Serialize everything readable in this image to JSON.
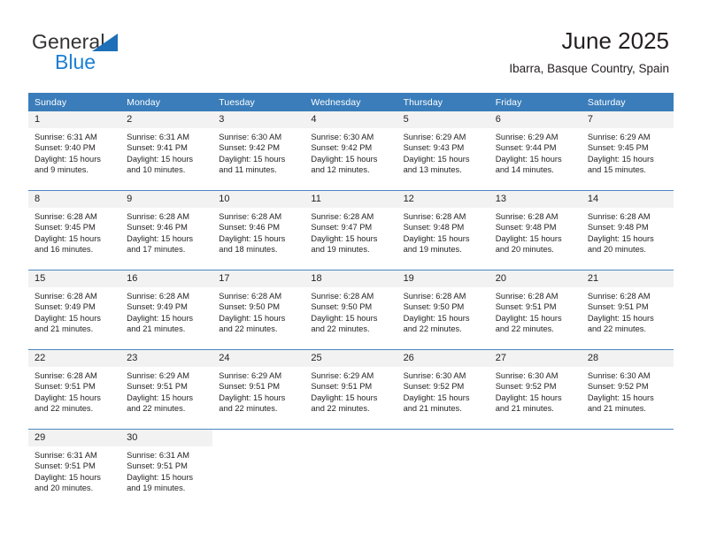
{
  "brand": {
    "name_top": "General",
    "name_bottom": "Blue",
    "triangle_color": "#1d6fb8",
    "blue_text_color": "#1b7fd4"
  },
  "header": {
    "title": "June 2025",
    "location": "Ibarra, Basque Country, Spain"
  },
  "theme": {
    "header_row_bg": "#3a7dba",
    "header_row_text": "#ffffff",
    "row_divider": "#4a86c4",
    "daynum_bg": "#f2f2f2",
    "body_text": "#231f20"
  },
  "weekdays": [
    "Sunday",
    "Monday",
    "Tuesday",
    "Wednesday",
    "Thursday",
    "Friday",
    "Saturday"
  ],
  "weeks": [
    [
      {
        "day": "1",
        "sunrise": "Sunrise: 6:31 AM",
        "sunset": "Sunset: 9:40 PM",
        "daylight_1": "Daylight: 15 hours",
        "daylight_2": "and 9 minutes."
      },
      {
        "day": "2",
        "sunrise": "Sunrise: 6:31 AM",
        "sunset": "Sunset: 9:41 PM",
        "daylight_1": "Daylight: 15 hours",
        "daylight_2": "and 10 minutes."
      },
      {
        "day": "3",
        "sunrise": "Sunrise: 6:30 AM",
        "sunset": "Sunset: 9:42 PM",
        "daylight_1": "Daylight: 15 hours",
        "daylight_2": "and 11 minutes."
      },
      {
        "day": "4",
        "sunrise": "Sunrise: 6:30 AM",
        "sunset": "Sunset: 9:42 PM",
        "daylight_1": "Daylight: 15 hours",
        "daylight_2": "and 12 minutes."
      },
      {
        "day": "5",
        "sunrise": "Sunrise: 6:29 AM",
        "sunset": "Sunset: 9:43 PM",
        "daylight_1": "Daylight: 15 hours",
        "daylight_2": "and 13 minutes."
      },
      {
        "day": "6",
        "sunrise": "Sunrise: 6:29 AM",
        "sunset": "Sunset: 9:44 PM",
        "daylight_1": "Daylight: 15 hours",
        "daylight_2": "and 14 minutes."
      },
      {
        "day": "7",
        "sunrise": "Sunrise: 6:29 AM",
        "sunset": "Sunset: 9:45 PM",
        "daylight_1": "Daylight: 15 hours",
        "daylight_2": "and 15 minutes."
      }
    ],
    [
      {
        "day": "8",
        "sunrise": "Sunrise: 6:28 AM",
        "sunset": "Sunset: 9:45 PM",
        "daylight_1": "Daylight: 15 hours",
        "daylight_2": "and 16 minutes."
      },
      {
        "day": "9",
        "sunrise": "Sunrise: 6:28 AM",
        "sunset": "Sunset: 9:46 PM",
        "daylight_1": "Daylight: 15 hours",
        "daylight_2": "and 17 minutes."
      },
      {
        "day": "10",
        "sunrise": "Sunrise: 6:28 AM",
        "sunset": "Sunset: 9:46 PM",
        "daylight_1": "Daylight: 15 hours",
        "daylight_2": "and 18 minutes."
      },
      {
        "day": "11",
        "sunrise": "Sunrise: 6:28 AM",
        "sunset": "Sunset: 9:47 PM",
        "daylight_1": "Daylight: 15 hours",
        "daylight_2": "and 19 minutes."
      },
      {
        "day": "12",
        "sunrise": "Sunrise: 6:28 AM",
        "sunset": "Sunset: 9:48 PM",
        "daylight_1": "Daylight: 15 hours",
        "daylight_2": "and 19 minutes."
      },
      {
        "day": "13",
        "sunrise": "Sunrise: 6:28 AM",
        "sunset": "Sunset: 9:48 PM",
        "daylight_1": "Daylight: 15 hours",
        "daylight_2": "and 20 minutes."
      },
      {
        "day": "14",
        "sunrise": "Sunrise: 6:28 AM",
        "sunset": "Sunset: 9:48 PM",
        "daylight_1": "Daylight: 15 hours",
        "daylight_2": "and 20 minutes."
      }
    ],
    [
      {
        "day": "15",
        "sunrise": "Sunrise: 6:28 AM",
        "sunset": "Sunset: 9:49 PM",
        "daylight_1": "Daylight: 15 hours",
        "daylight_2": "and 21 minutes."
      },
      {
        "day": "16",
        "sunrise": "Sunrise: 6:28 AM",
        "sunset": "Sunset: 9:49 PM",
        "daylight_1": "Daylight: 15 hours",
        "daylight_2": "and 21 minutes."
      },
      {
        "day": "17",
        "sunrise": "Sunrise: 6:28 AM",
        "sunset": "Sunset: 9:50 PM",
        "daylight_1": "Daylight: 15 hours",
        "daylight_2": "and 22 minutes."
      },
      {
        "day": "18",
        "sunrise": "Sunrise: 6:28 AM",
        "sunset": "Sunset: 9:50 PM",
        "daylight_1": "Daylight: 15 hours",
        "daylight_2": "and 22 minutes."
      },
      {
        "day": "19",
        "sunrise": "Sunrise: 6:28 AM",
        "sunset": "Sunset: 9:50 PM",
        "daylight_1": "Daylight: 15 hours",
        "daylight_2": "and 22 minutes."
      },
      {
        "day": "20",
        "sunrise": "Sunrise: 6:28 AM",
        "sunset": "Sunset: 9:51 PM",
        "daylight_1": "Daylight: 15 hours",
        "daylight_2": "and 22 minutes."
      },
      {
        "day": "21",
        "sunrise": "Sunrise: 6:28 AM",
        "sunset": "Sunset: 9:51 PM",
        "daylight_1": "Daylight: 15 hours",
        "daylight_2": "and 22 minutes."
      }
    ],
    [
      {
        "day": "22",
        "sunrise": "Sunrise: 6:28 AM",
        "sunset": "Sunset: 9:51 PM",
        "daylight_1": "Daylight: 15 hours",
        "daylight_2": "and 22 minutes."
      },
      {
        "day": "23",
        "sunrise": "Sunrise: 6:29 AM",
        "sunset": "Sunset: 9:51 PM",
        "daylight_1": "Daylight: 15 hours",
        "daylight_2": "and 22 minutes."
      },
      {
        "day": "24",
        "sunrise": "Sunrise: 6:29 AM",
        "sunset": "Sunset: 9:51 PM",
        "daylight_1": "Daylight: 15 hours",
        "daylight_2": "and 22 minutes."
      },
      {
        "day": "25",
        "sunrise": "Sunrise: 6:29 AM",
        "sunset": "Sunset: 9:51 PM",
        "daylight_1": "Daylight: 15 hours",
        "daylight_2": "and 22 minutes."
      },
      {
        "day": "26",
        "sunrise": "Sunrise: 6:30 AM",
        "sunset": "Sunset: 9:52 PM",
        "daylight_1": "Daylight: 15 hours",
        "daylight_2": "and 21 minutes."
      },
      {
        "day": "27",
        "sunrise": "Sunrise: 6:30 AM",
        "sunset": "Sunset: 9:52 PM",
        "daylight_1": "Daylight: 15 hours",
        "daylight_2": "and 21 minutes."
      },
      {
        "day": "28",
        "sunrise": "Sunrise: 6:30 AM",
        "sunset": "Sunset: 9:52 PM",
        "daylight_1": "Daylight: 15 hours",
        "daylight_2": "and 21 minutes."
      }
    ],
    [
      {
        "day": "29",
        "sunrise": "Sunrise: 6:31 AM",
        "sunset": "Sunset: 9:51 PM",
        "daylight_1": "Daylight: 15 hours",
        "daylight_2": "and 20 minutes."
      },
      {
        "day": "30",
        "sunrise": "Sunrise: 6:31 AM",
        "sunset": "Sunset: 9:51 PM",
        "daylight_1": "Daylight: 15 hours",
        "daylight_2": "and 19 minutes."
      },
      {
        "day": "",
        "sunrise": "",
        "sunset": "",
        "daylight_1": "",
        "daylight_2": "",
        "blank": true
      },
      {
        "day": "",
        "sunrise": "",
        "sunset": "",
        "daylight_1": "",
        "daylight_2": "",
        "blank": true
      },
      {
        "day": "",
        "sunrise": "",
        "sunset": "",
        "daylight_1": "",
        "daylight_2": "",
        "blank": true
      },
      {
        "day": "",
        "sunrise": "",
        "sunset": "",
        "daylight_1": "",
        "daylight_2": "",
        "blank": true
      },
      {
        "day": "",
        "sunrise": "",
        "sunset": "",
        "daylight_1": "",
        "daylight_2": "",
        "blank": true
      }
    ]
  ]
}
